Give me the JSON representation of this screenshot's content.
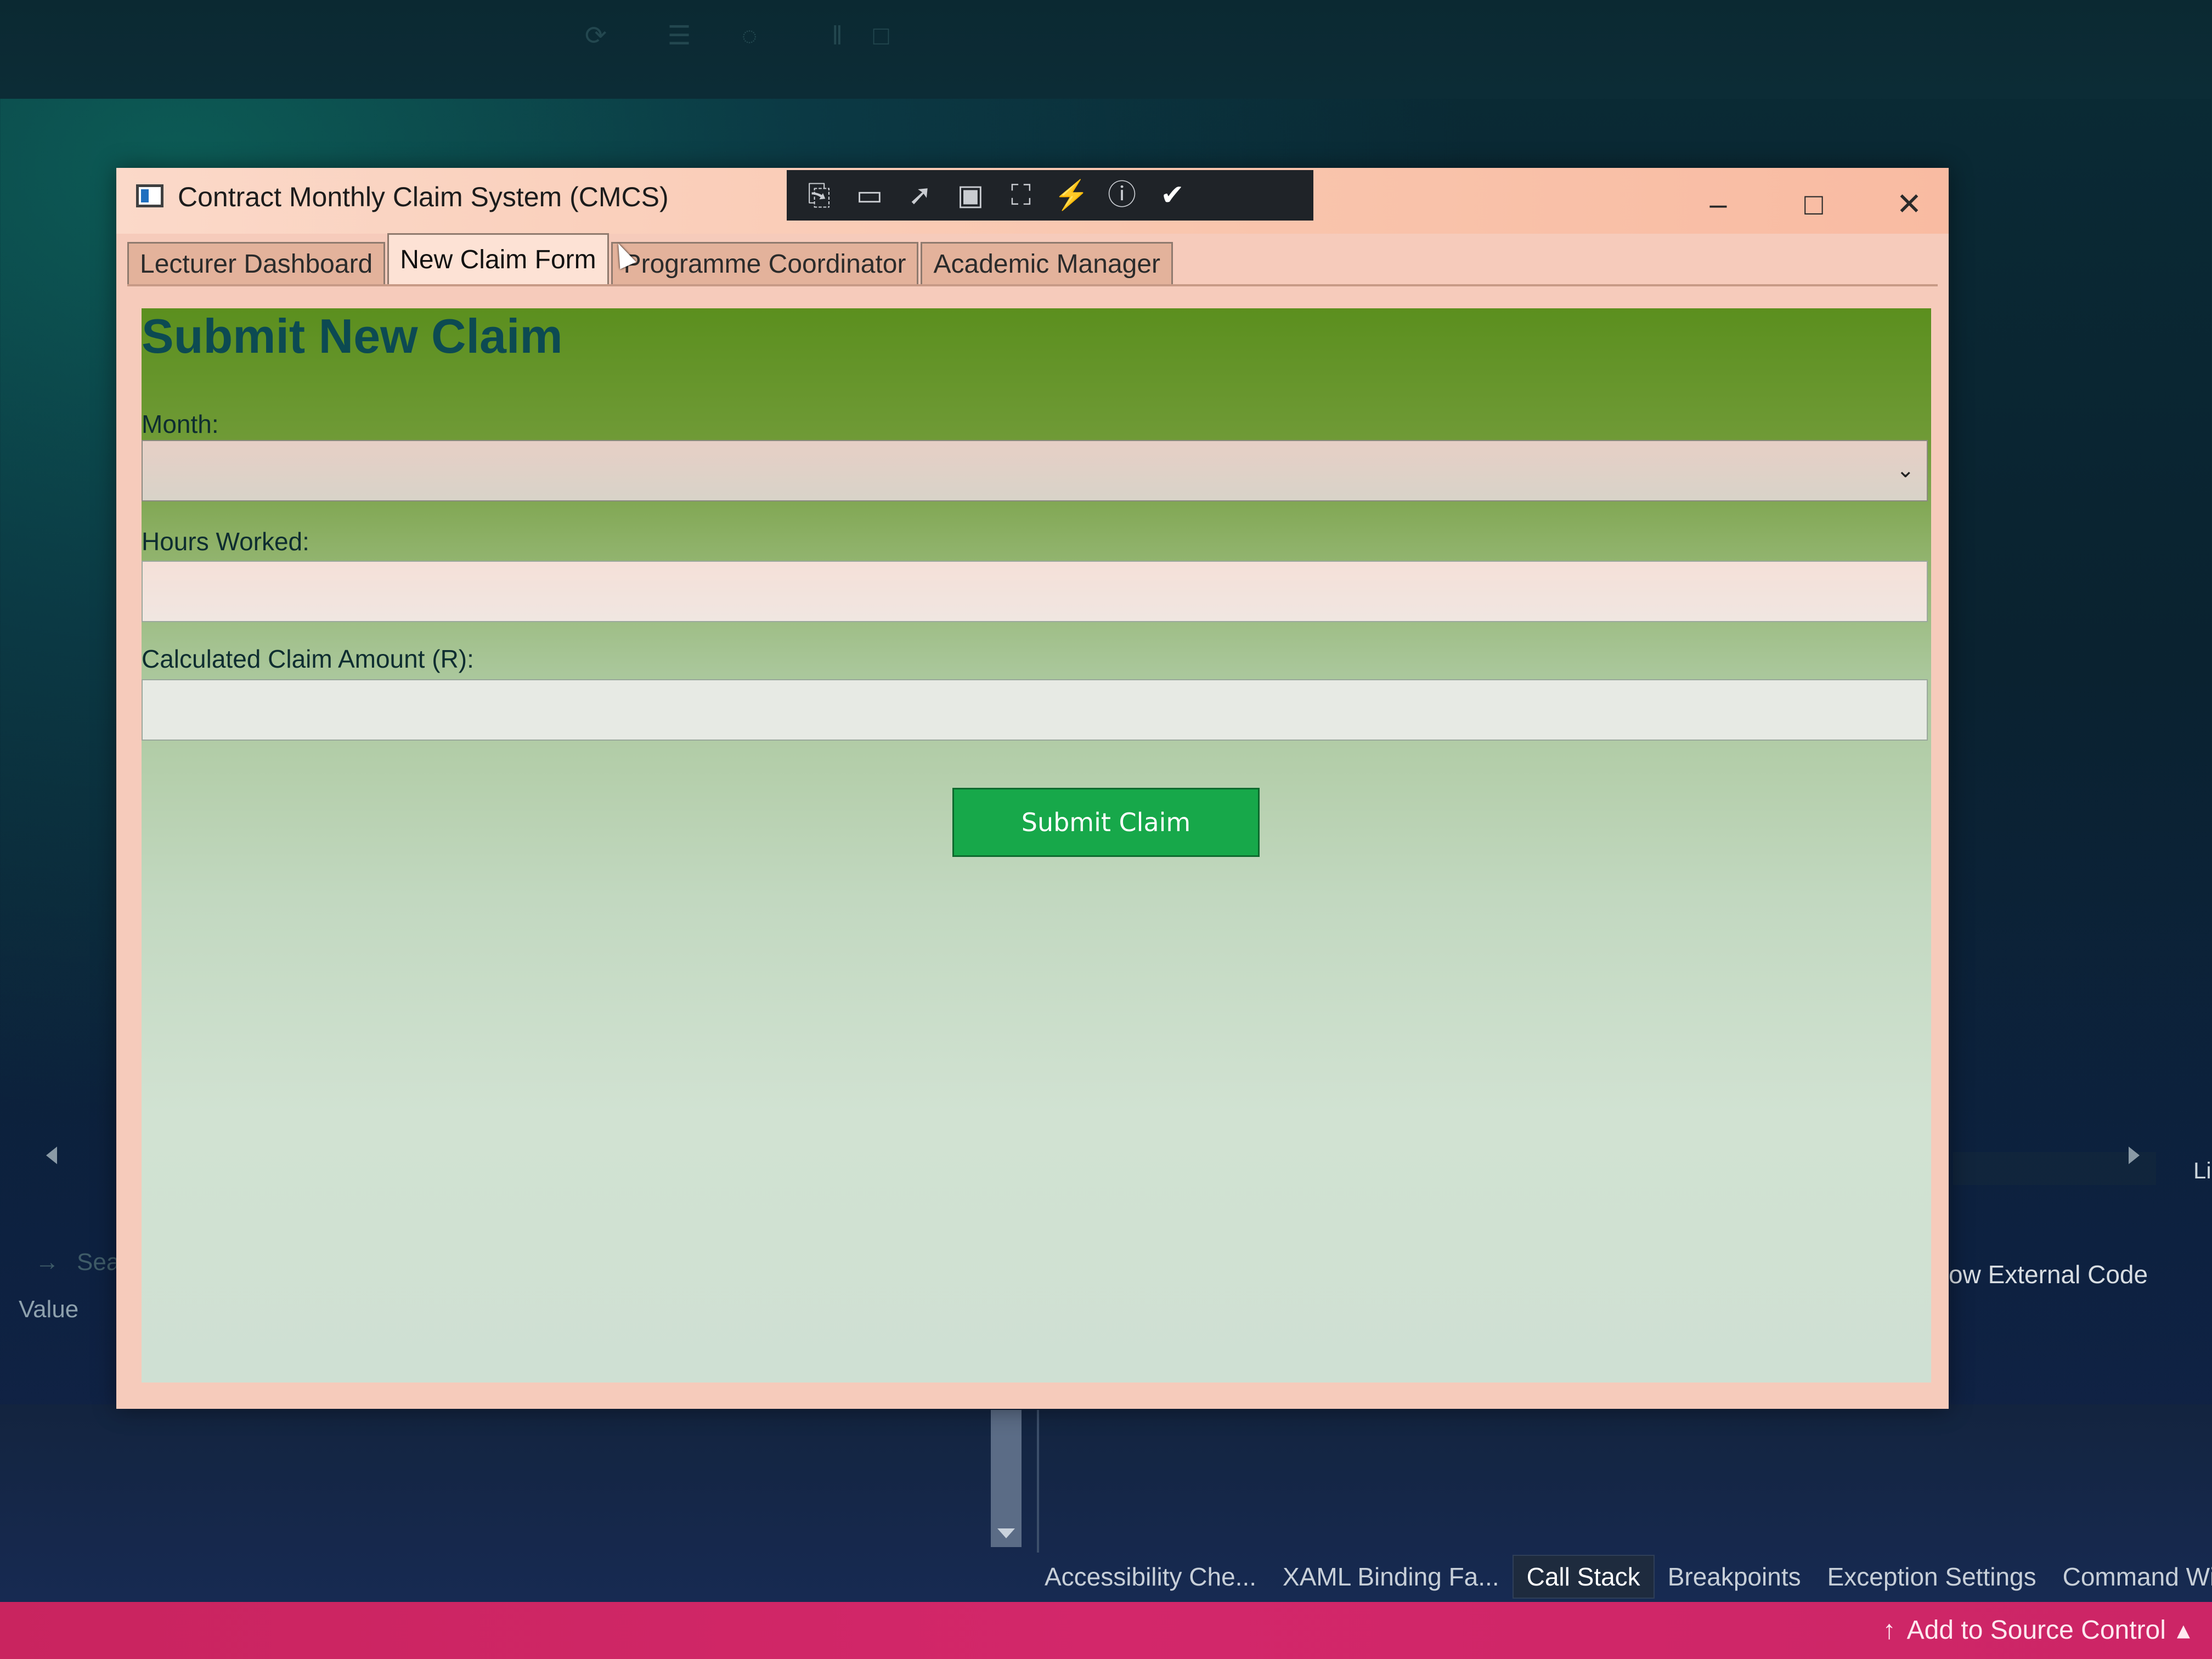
{
  "app": {
    "title": "Contract Monthly Claim System (CMCS)"
  },
  "tabs": [
    {
      "label": "Lecturer Dashboard",
      "selected": false
    },
    {
      "label": "New Claim Form",
      "selected": true
    },
    {
      "label": "Programme Coordinator",
      "selected": false
    },
    {
      "label": "Academic Manager",
      "selected": false
    }
  ],
  "form": {
    "title": "Submit New Claim",
    "month_label": "Month:",
    "month_value": "",
    "hours_label": "Hours Worked:",
    "hours_value": "",
    "amount_label": "Calculated Claim Amount (R):",
    "amount_value": "",
    "submit_label": "Submit Claim"
  },
  "ide": {
    "search_label": "Sea",
    "value_label": "Value",
    "external_code_label": "ow External Code",
    "language_label": "Li",
    "bottom_tabs": [
      {
        "label": "Accessibility Che...",
        "active": false
      },
      {
        "label": "XAML Binding Fa...",
        "active": false
      },
      {
        "label": "Call Stack",
        "active": true
      },
      {
        "label": "Breakpoints",
        "active": false
      },
      {
        "label": "Exception Settings",
        "active": false
      },
      {
        "label": "Command Wind...",
        "active": false
      }
    ],
    "status_source": "Add to Source Control"
  },
  "colors": {
    "accent_green": "#17a84a",
    "status_bar": "#d3276a",
    "title_text": "#0c4a52"
  }
}
